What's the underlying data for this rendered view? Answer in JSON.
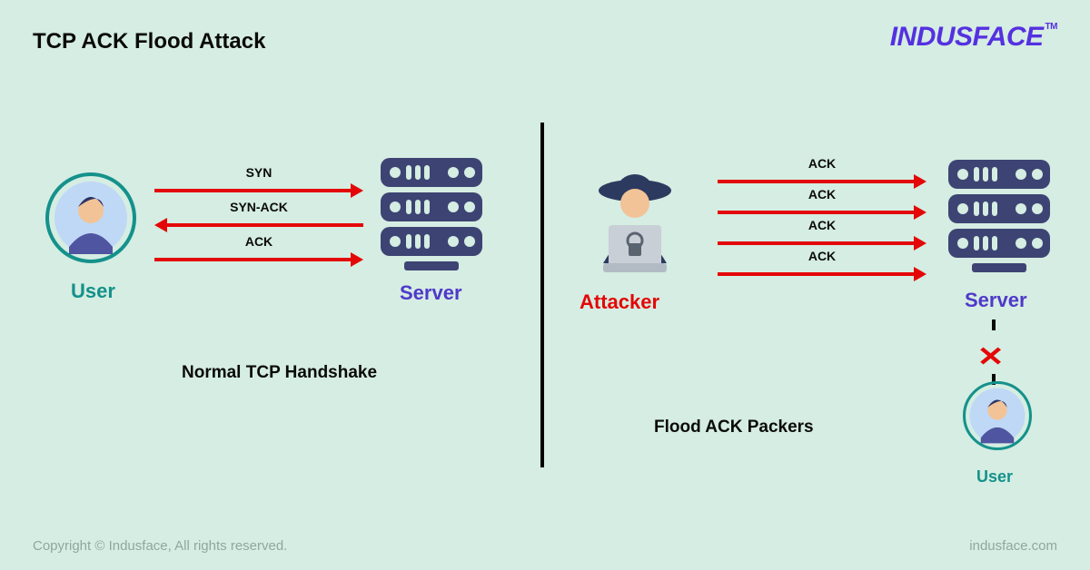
{
  "title": "TCP ACK Flood Attack",
  "brand": "INDUSFACE",
  "brand_tm": "TM",
  "footer_left": "Copyright © Indusface, All rights reserved.",
  "footer_right": "indusface.com",
  "left": {
    "user_label": "User",
    "server_label": "Server",
    "caption": "Normal TCP Handshake",
    "arrows": {
      "syn": "SYN",
      "synack": "SYN-ACK",
      "ack": "ACK"
    }
  },
  "right": {
    "attacker_label": "Attacker",
    "server_label": "Server",
    "user_label": "User",
    "caption": "Flood ACK Packers",
    "ack": "ACK"
  },
  "colors": {
    "accent_teal": "#14918b",
    "accent_purple": "#4f39c9",
    "arrow_red": "#e40707",
    "brand_purple": "#5530e0",
    "bg": "#d5ede2"
  }
}
